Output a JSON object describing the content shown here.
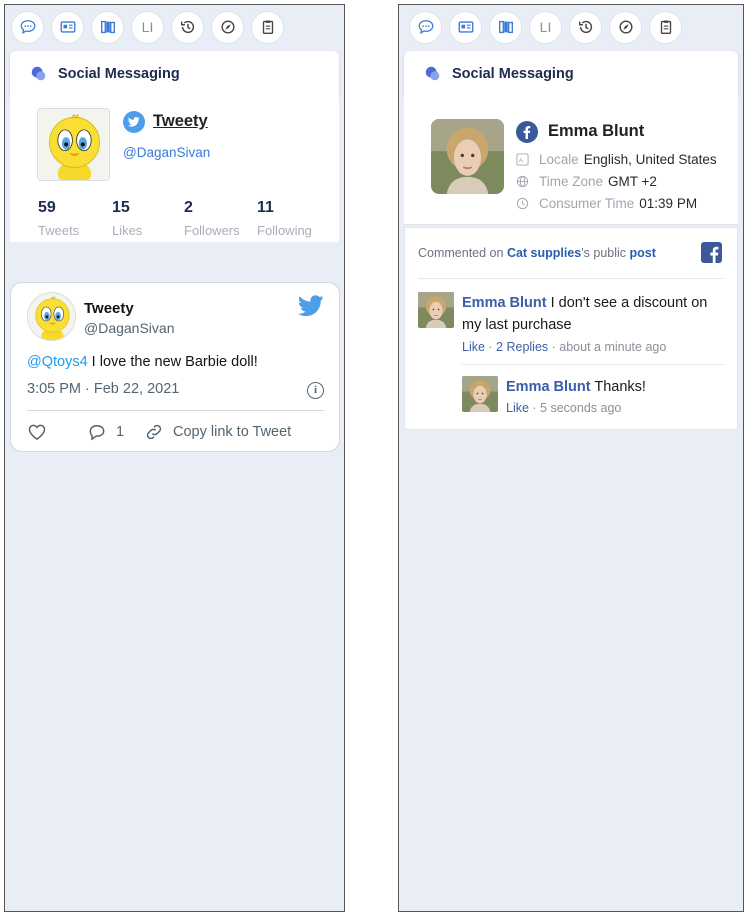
{
  "toolbar_icons": [
    "chat-bubble-icon",
    "contact-card-icon",
    "books-icon",
    "li-text-icon",
    "history-icon",
    "compass-icon",
    "clipboard-icon"
  ],
  "toolbar_text": {
    "li": "LI"
  },
  "left": {
    "header": {
      "title": "Social Messaging"
    },
    "profile": {
      "name": "Tweety",
      "handle": "@DaganSivan",
      "stats": [
        {
          "num": "59",
          "label": "Tweets"
        },
        {
          "num": "15",
          "label": "Likes"
        },
        {
          "num": "2",
          "label": "Followers"
        },
        {
          "num": "11",
          "label": "Following"
        }
      ]
    },
    "tweet": {
      "name": "Tweety",
      "handle": "@DaganSivan",
      "mention": "@Qtoys4",
      "text": " I love the new Barbie doll!",
      "time": "3:05 PM · Feb 22, 2021",
      "reply_count": "1",
      "copy_link": "Copy link to Tweet"
    }
  },
  "right": {
    "header": {
      "title": "Social Messaging"
    },
    "profile": {
      "name": "Emma Blunt",
      "locale_label": "Locale",
      "locale_value": "English, United States",
      "timezone_label": "Time Zone",
      "timezone_value": "GMT +2",
      "consumer_time_label": "Consumer Time",
      "consumer_time_value": "01:39 PM"
    },
    "thread": {
      "prefix": "Commented on ",
      "page": "Cat supplies",
      "middle": "'s public ",
      "post": "post",
      "comment": {
        "author": "Emma Blunt",
        "text": " I don't see a discount on my last purchase",
        "like": "Like",
        "replies": "2 Replies",
        "time": " · about a minute ago"
      },
      "reply": {
        "author": "Emma Blunt",
        "text": " Thanks!",
        "like": "Like",
        "time": " · 5 seconds ago"
      }
    }
  },
  "colors": {
    "accent": "#3b7bd8",
    "twitter": "#1d9bf0",
    "facebook": "#3b5998",
    "panel_bg": "#e9edf5"
  }
}
